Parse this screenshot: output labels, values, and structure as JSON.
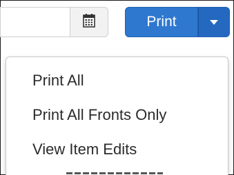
{
  "date_input": {
    "value": "",
    "placeholder": ""
  },
  "calendar_button": {
    "icon": "calendar-icon"
  },
  "print_button": {
    "label": "Print",
    "color": "#2f78d0"
  },
  "dropdown_toggle": {
    "icon": "caret-down-icon"
  },
  "menu": {
    "items": [
      {
        "label": "Print All"
      },
      {
        "label": "Print All Fronts Only"
      },
      {
        "label": "View Item Edits"
      }
    ]
  }
}
